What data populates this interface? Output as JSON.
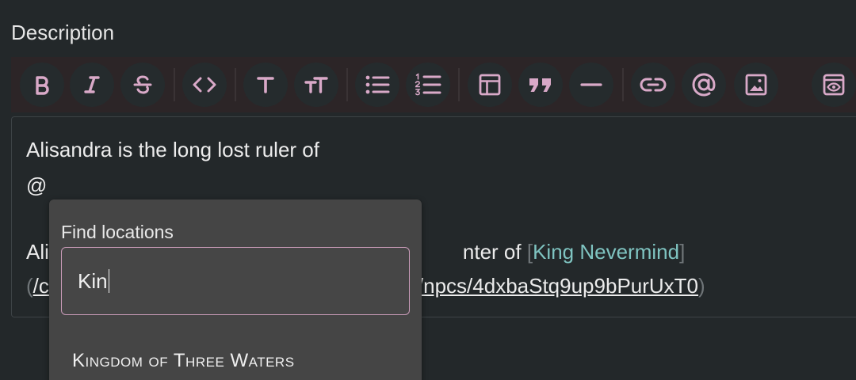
{
  "field": {
    "label": "Description"
  },
  "toolbar": {
    "icons": [
      "bold-icon",
      "italic-icon",
      "strikethrough-icon",
      "code-icon",
      "heading-icon",
      "heading-size-icon",
      "bullet-list-icon",
      "numbered-list-icon",
      "table-icon",
      "quote-icon",
      "horizontal-rule-icon",
      "link-icon",
      "mention-icon",
      "image-icon",
      "preview-icon"
    ]
  },
  "editor": {
    "line1": "Alisandra is the long lost ruler of",
    "line2": "@",
    "line3_prefix": "Ali",
    "line3_suffix": "nter of ",
    "bracket_open": "[",
    "link_text": "King Nevermind",
    "bracket_close": "]",
    "line4_paren_open": "(",
    "line4_url_start": "/c",
    "line4_url_end": "z/npcs/4dxbaStq9up9bPurUxT0",
    "line4_paren_close": ")"
  },
  "mention_dropdown": {
    "label": "Find locations",
    "search_value": "Kin",
    "results": [
      "Kingdom of Three Waters"
    ]
  },
  "colors": {
    "background": "#23282a",
    "accent_pink": "#d9a9c8",
    "link_teal": "#7fc4c1",
    "dropdown_bg": "#454545"
  }
}
